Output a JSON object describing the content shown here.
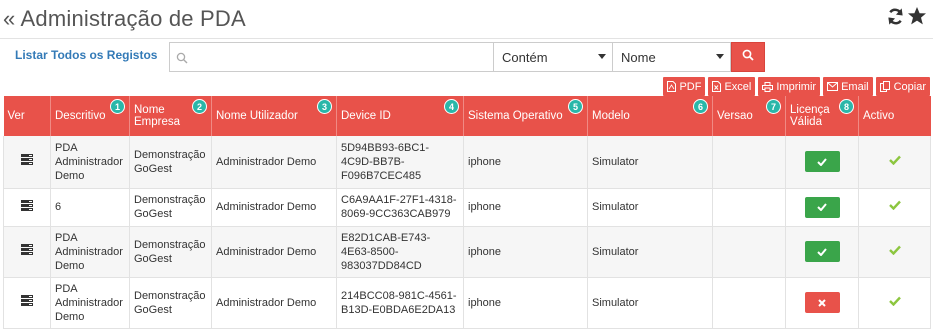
{
  "header": {
    "title": "« Administração de PDA",
    "icons": [
      "refresh-icon",
      "star-icon"
    ]
  },
  "toolbar": {
    "list_all_label": "Listar Todos os Registos",
    "search_placeholder": "",
    "search_value": "",
    "operator_selected": "Contém",
    "field_selected": "Nome"
  },
  "exports": [
    {
      "label": "PDF",
      "icon": "pdf-icon"
    },
    {
      "label": "Excel",
      "icon": "excel-icon"
    },
    {
      "label": "Imprimir",
      "icon": "print-icon"
    },
    {
      "label": "Email",
      "icon": "email-icon"
    },
    {
      "label": "Copiar",
      "icon": "copy-icon"
    }
  ],
  "columns": [
    {
      "label": "Ver",
      "num": ""
    },
    {
      "label": "Descritivo",
      "num": "1"
    },
    {
      "label": "Nome Empresa",
      "num": "2"
    },
    {
      "label": "Nome Utilizador",
      "num": "3"
    },
    {
      "label": "Device ID",
      "num": "4"
    },
    {
      "label": "Sistema Operativo",
      "num": "5"
    },
    {
      "label": "Modelo",
      "num": "6"
    },
    {
      "label": "Versao",
      "num": "7"
    },
    {
      "label": "Licença Válida",
      "num": "8"
    },
    {
      "label": "Activo",
      "num": ""
    }
  ],
  "rows": [
    {
      "descritivo": "PDA Administrador Demo",
      "empresa": "Demonstração GoGest",
      "utilizador": "Administrador Demo",
      "device_id": "5D94BB93-6BC1-4C9D-BB7B-F096B7CEC485",
      "sistema": "iphone",
      "modelo": "Simulator",
      "versao": "",
      "licenca_valida": true,
      "activo": true
    },
    {
      "descritivo": "6",
      "empresa": "Demonstração GoGest",
      "utilizador": "Administrador Demo",
      "device_id": "C6A9AA1F-27F1-4318-8069-9CC363CAB979",
      "sistema": "iphone",
      "modelo": "Simulator",
      "versao": "",
      "licenca_valida": true,
      "activo": true
    },
    {
      "descritivo": "PDA Administrador Demo",
      "empresa": "Demonstração GoGest",
      "utilizador": "Administrador Demo",
      "device_id": "E82D1CAB-E743-4E63-8500-983037DD84CD",
      "sistema": "iphone",
      "modelo": "Simulator",
      "versao": "",
      "licenca_valida": true,
      "activo": true
    },
    {
      "descritivo": "PDA Administrador Demo",
      "empresa": "Demonstração GoGest",
      "utilizador": "Administrador Demo",
      "device_id": "214BCC08-981C-4561-B13D-E0BDA6E2DA13",
      "sistema": "iphone",
      "modelo": "Simulator",
      "versao": "",
      "licenca_valida": false,
      "activo": true
    }
  ],
  "colors": {
    "accent": "#e8524a",
    "badge": "#2ab7a9",
    "valid": "#3aa54a",
    "check": "#8cc63f",
    "link": "#337ab7"
  }
}
